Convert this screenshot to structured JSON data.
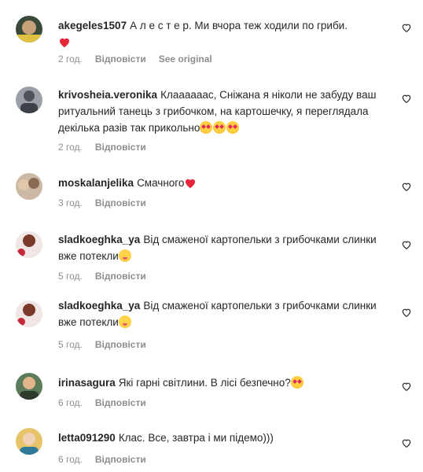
{
  "comments": [
    {
      "username": "akegeles1507",
      "text": "А л е с т е р. Ми вчора теж ходили по гриби.",
      "time": "2 год.",
      "reply": "Відповісти",
      "see_original": "See original",
      "emoji": [
        "red-heart"
      ]
    },
    {
      "username": "krivosheia.veronika",
      "text": "Клаааааас, Сніжана я ніколи не забуду ваш ритуальний танець з грибочком, на картошечку, я переглядала декілька разів так прикольно",
      "time": "2 год.",
      "reply": "Відповісти",
      "emoji": [
        "star-struck",
        "star-struck",
        "star-struck"
      ]
    },
    {
      "username": "moskalanjelika",
      "text": "Смачного",
      "time": "3 год.",
      "reply": "Відповісти",
      "emoji": [
        "red-heart"
      ]
    },
    {
      "username": "sladkoeghka_ya",
      "text": "Від смаженої картопельки з грибочками слинки вже потекли",
      "time": "5 год.",
      "reply": "Відповісти",
      "emoji": [
        "yum"
      ]
    },
    {
      "username": "sladkoeghka_ya",
      "text": "Від смаженої картопельки з грибочками слинки вже потекли",
      "time": "5 год.",
      "reply": "Відповісти",
      "emoji": [
        "yum"
      ]
    },
    {
      "username": "irinasagura",
      "text": "Які гарні світлини. В лісі безпечно?",
      "time": "6 год.",
      "reply": "Відповісти",
      "emoji": [
        "star-struck"
      ]
    },
    {
      "username": "letta091290",
      "text": "Клас. Все, завтра і ми підемо)))",
      "time": "6 год.",
      "reply": "Відповісти",
      "emoji": []
    }
  ]
}
